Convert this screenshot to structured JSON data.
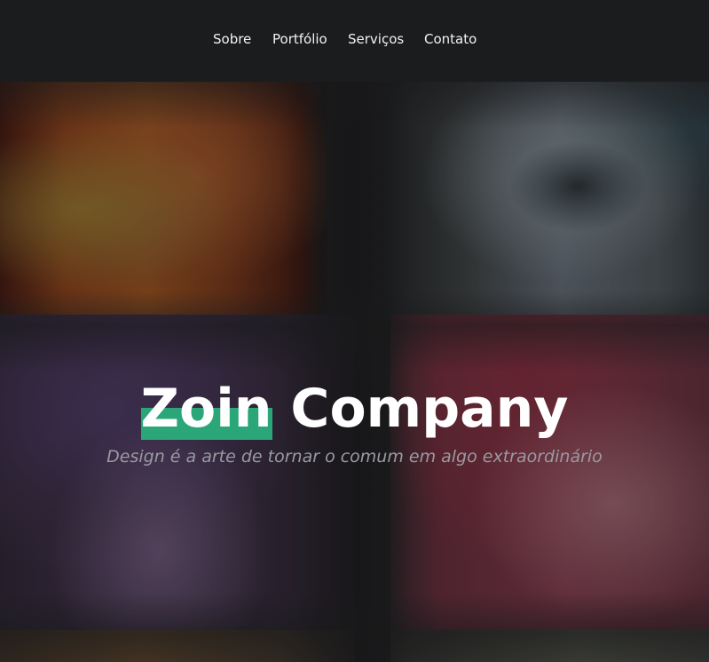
{
  "nav": {
    "items": [
      {
        "label": "Sobre"
      },
      {
        "label": "Portfólio"
      },
      {
        "label": "Serviços"
      },
      {
        "label": "Contato"
      }
    ]
  },
  "hero": {
    "title_highlight": "Zoin",
    "title_rest": "Company",
    "tagline": "Design é a arte de tornar o comum em algo extraordinário"
  },
  "colors": {
    "nav_background": "#1b1c1e",
    "accent": "#2aa679",
    "title_text": "#ffffff",
    "tagline_text": "#9a9aa2"
  }
}
